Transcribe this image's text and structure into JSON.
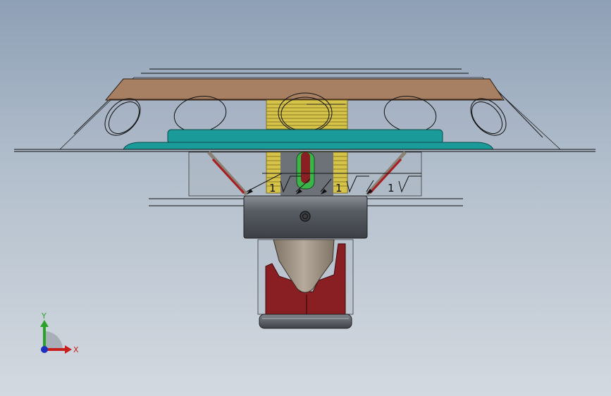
{
  "view": {
    "background_top": "#8ea0b6",
    "background_bottom": "#d3d9e0"
  },
  "model": {
    "colors": {
      "deflector": "#a77f62",
      "frame_plate": "#1a9a98",
      "thread": "#d6c34a",
      "body": "#585c63",
      "bulb": "#8a1f23",
      "seal": "#3bb54a",
      "yoke": "#8a8074"
    },
    "annotations": [
      {
        "text": "1",
        "icon": "surface-finish-symbol"
      },
      {
        "text": "1",
        "icon": "surface-finish-symbol"
      },
      {
        "text": "1",
        "icon": "surface-finish-symbol"
      }
    ]
  },
  "triad": {
    "x_label": "X",
    "y_label": "Y",
    "x_color": "#c81e1e",
    "y_color": "#2ba32b",
    "z_color": "#1c2fbf"
  }
}
